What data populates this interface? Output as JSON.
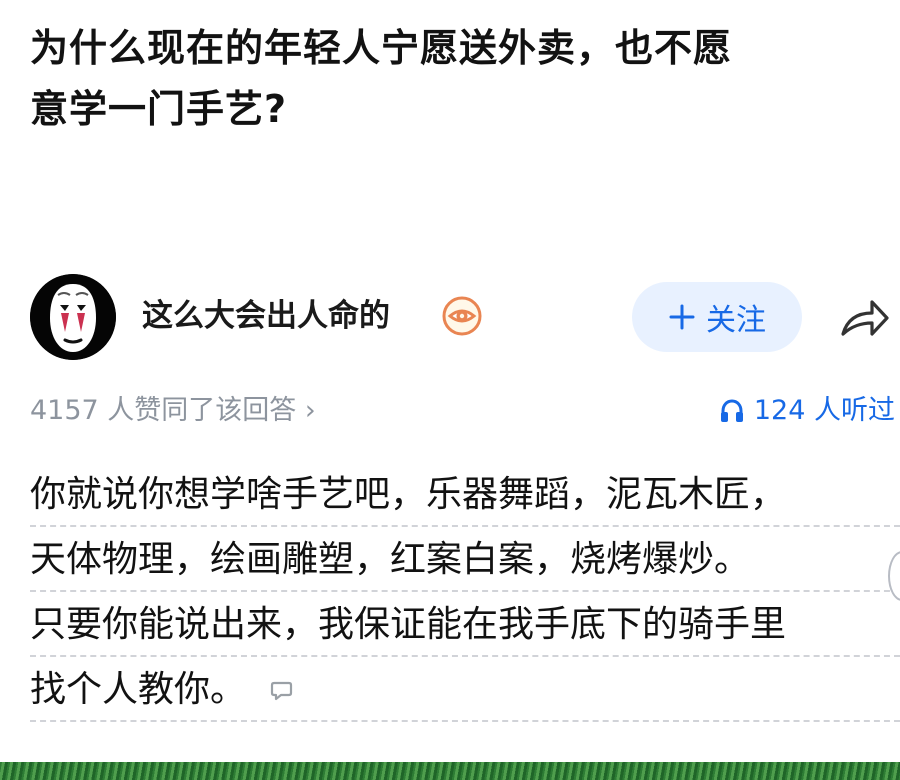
{
  "question": {
    "title_line_1": "为什么现在的年轻人宁愿送外卖，也不愿",
    "title_line_2": "意学一门手艺?"
  },
  "author": {
    "name": "这么大会出人命的",
    "avatar_icon": "no-face-mask-avatar",
    "badge_icon": "eye-badge-icon"
  },
  "actions": {
    "follow_label": "关注",
    "follow_icon": "plus-icon",
    "share_icon": "share-arrow-icon"
  },
  "stats": {
    "approval_text": "4157 人赞同了该回答 ›",
    "listen_text": "124 人听过",
    "listen_icon": "headphones-icon"
  },
  "answer": {
    "lines": [
      "你就说你想学啥手艺吧，乐器舞蹈，泥瓦木匠，",
      "天体物理，绘画雕塑，红案白案，烧烤爆炒。",
      "只要你能说出来，我保证能在我手底下的骑手里",
      "找个人教你。"
    ],
    "comment_icon": "comment-bubble-icon"
  },
  "colors": {
    "accent": "#1769e6",
    "follow_bg": "#e8f1ff",
    "muted_text": "#8d949e",
    "badge": "#e98552"
  }
}
